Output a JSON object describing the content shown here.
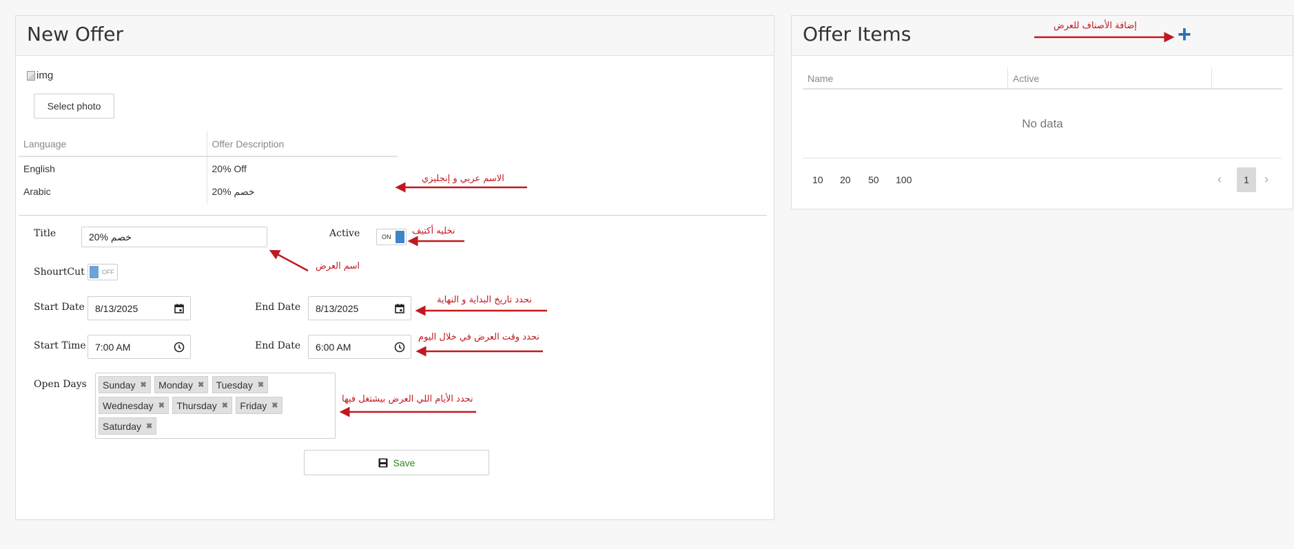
{
  "offer": {
    "title": "New Offer",
    "broken_image_alt": "img",
    "select_photo_label": "Select photo",
    "lang_table": {
      "headers": [
        "Language",
        "Offer Description"
      ],
      "rows": [
        [
          "English",
          "20% Off"
        ],
        [
          "Arabic",
          "20% خصم"
        ]
      ]
    },
    "form": {
      "title_label": "Title",
      "title_value": "20% خصم",
      "active_label": "Active",
      "active_toggle": "ON",
      "shortcut_label": "ShourtCut",
      "shortcut_toggle": "OFF",
      "start_date_label": "Start Date",
      "start_date_value": "8/13/2025",
      "end_date_label": "End Date",
      "end_date_value": "8/13/2025",
      "start_time_label": "Start Time",
      "start_time_value": "7:00 AM",
      "end_time_label": "End Date",
      "end_time_value": "6:00 AM",
      "open_days_label": "Open Days",
      "open_days": [
        "Sunday",
        "Monday",
        "Tuesday",
        "Wednesday",
        "Thursday",
        "Friday",
        "Saturday"
      ],
      "save_label": "Save"
    }
  },
  "items": {
    "title": "Offer Items",
    "columns": [
      "Name",
      "Active",
      ""
    ],
    "empty_text": "No data",
    "page_sizes": [
      "10",
      "20",
      "50",
      "100"
    ],
    "current_page": "1"
  },
  "annotations": {
    "add_items": "إضافة الأصناف للعرض",
    "name_ar_en": "الاسم عربي و إنجليزي",
    "make_active": "نخليه أكتيف",
    "offer_name": "اسم العرض",
    "dates": "نحدد تاريخ البداية و النهاية",
    "times": "نحدد وقت العرض في خلال اليوم",
    "days": "نحدد الأيام اللي العرض بيشتغل فيها"
  },
  "colors": {
    "annotation": "#c0181f",
    "accent": "#3d85c6",
    "save_text": "#2b8a1b"
  }
}
